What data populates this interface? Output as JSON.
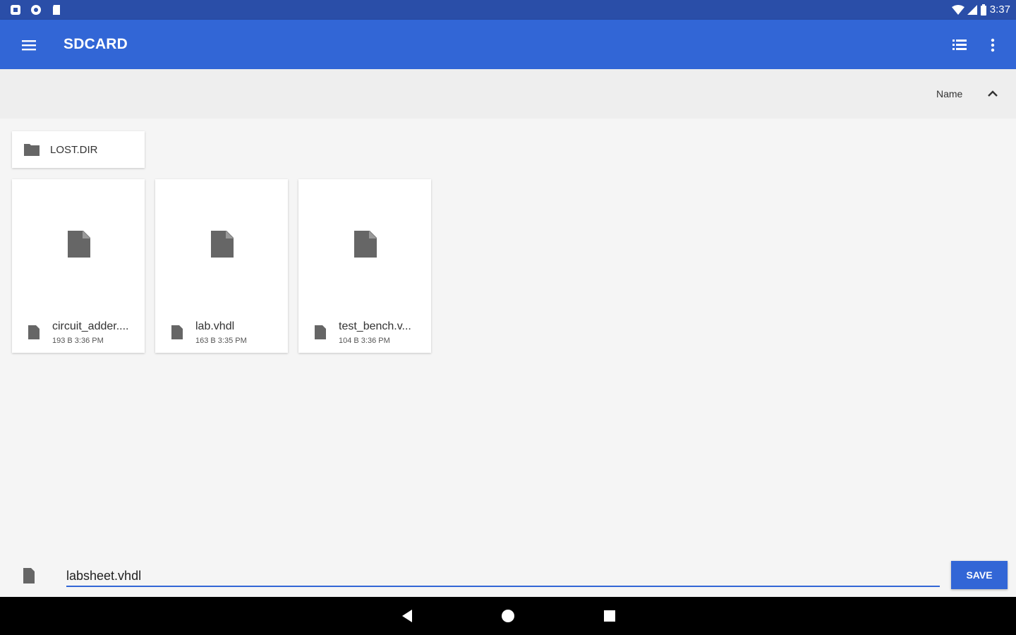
{
  "status_bar": {
    "time": "3:37"
  },
  "app_bar": {
    "title": "SDCARD"
  },
  "sort": {
    "label": "Name",
    "direction": "ascending"
  },
  "folders": [
    {
      "name": "LOST.DIR"
    }
  ],
  "files": [
    {
      "name": "circuit_adder....",
      "meta": "193 B 3:36 PM"
    },
    {
      "name": "lab.vhdl",
      "meta": "163 B 3:35 PM"
    },
    {
      "name": "test_bench.v...",
      "meta": "104 B 3:36 PM"
    }
  ],
  "save_bar": {
    "filename": "labsheet.vhdl",
    "save_label": "SAVE"
  },
  "colors": {
    "status_bar": "#2a4ea8",
    "app_bar": "#3266d6",
    "accent": "#3266d6"
  }
}
